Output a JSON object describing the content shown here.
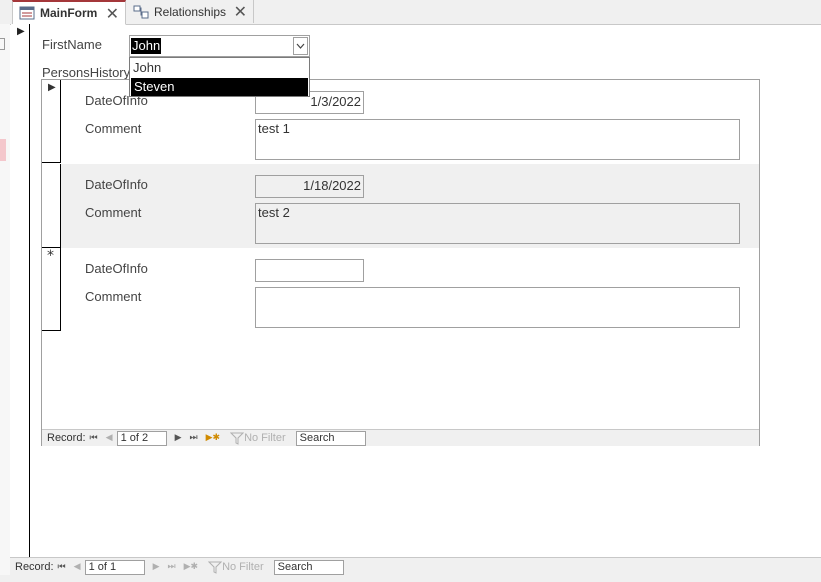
{
  "tabs": [
    {
      "label": "MainForm",
      "active": true
    },
    {
      "label": "Relationships",
      "active": false
    }
  ],
  "main_form": {
    "firstname_label": "FirstName",
    "firstname_value": "John",
    "dropdown_options": [
      "John",
      "Steven"
    ],
    "dropdown_highlighted": "Steven",
    "subform_label": "PersonsHistory"
  },
  "subform": {
    "records": [
      {
        "date_label": "DateOfInfo",
        "date_value": "1/3/2022",
        "comment_label": "Comment",
        "comment_value": "test 1"
      },
      {
        "date_label": "DateOfInfo",
        "date_value": "1/18/2022",
        "comment_label": "Comment",
        "comment_value": "test 2"
      },
      {
        "date_label": "DateOfInfo",
        "date_value": "",
        "comment_label": "Comment",
        "comment_value": ""
      }
    ],
    "new_record_marker": "*",
    "nav": {
      "record_label": "Record:",
      "position": "1 of 2",
      "filter": "No Filter",
      "search": "Search"
    }
  },
  "main_nav": {
    "record_label": "Record:",
    "position": "1 of 1",
    "filter": "No Filter",
    "search": "Search"
  },
  "colors": {
    "accent": "#a4373a",
    "selected": "#000000",
    "alt_row": "#f0f0f0"
  }
}
